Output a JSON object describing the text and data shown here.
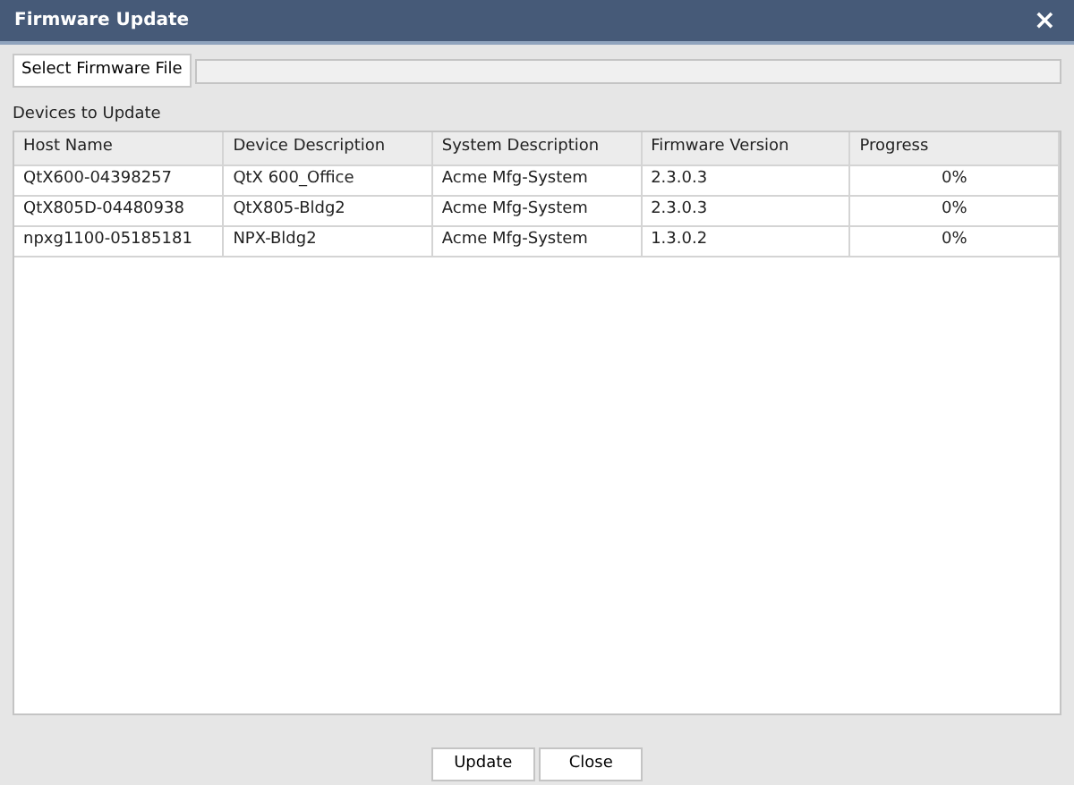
{
  "window": {
    "title": "Firmware Update",
    "close": "×"
  },
  "file_select": {
    "button": "Select Firmware File"
  },
  "devices_label": "Devices to Update",
  "table": {
    "columns": [
      "Host Name",
      "Device Description",
      "System Description",
      "Firmware Version",
      "Progress"
    ],
    "rows": [
      [
        "QtX600-04398257",
        "QtX 600_Office",
        "Acme Mfg-System",
        "2.3.0.3",
        "0%"
      ],
      [
        "QtX805D-04480938",
        "QtX805-Bldg2",
        "Acme Mfg-System",
        "2.3.0.3",
        "0%"
      ],
      [
        "npxg1100-05185181",
        "NPX-Bldg2",
        "Acme Mfg-System",
        "1.3.0.2",
        "0%"
      ]
    ]
  },
  "buttons": [
    "Update",
    "Close"
  ]
}
